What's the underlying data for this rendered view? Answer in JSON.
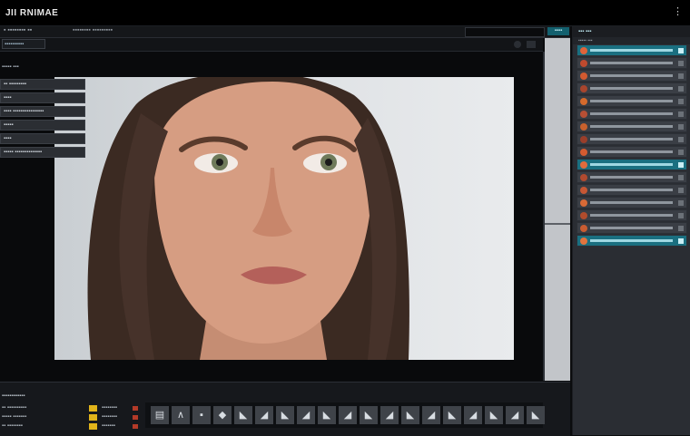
{
  "app": {
    "title": "JII RNIMAE"
  },
  "toolstrip": {
    "left_text": "▪ ▪▪▪▪▪▪▪▪ ▪▪",
    "mid_text": "▪▪▪▪▪▪▪▪ ▪▪▪▪▪▪▪▪▪",
    "badge": "▪▪▪▪"
  },
  "subbar": {
    "file_tab": "▪▪▪▪▪▪▪▪▪▪"
  },
  "viewport": {
    "label": "▪▪▪▪▪ ▪▪▪"
  },
  "properties": [
    "▪▪ ▪▪▪▪▪▪▪▪▪",
    "▪▪▪▪",
    "▪▪▪▪ ▪▪▪▪▪▪▪▪▪▪▪▪▪▪▪▪",
    "▪▪▪▪▪",
    "▪▪▪▪",
    "▪▪▪▪▪ ▪▪▪▪▪▪▪▪▪▪▪▪▪▪"
  ],
  "right_panel": {
    "header": "▪▪▪ ▪▪▪",
    "subheader": "▪▪▪▪▪ ▪▪▪"
  },
  "layers": [
    {
      "active": true,
      "color": "#e0643a"
    },
    {
      "active": false,
      "color": "#c04a2e"
    },
    {
      "active": false,
      "color": "#d25a30"
    },
    {
      "active": false,
      "color": "#a8452d"
    },
    {
      "active": false,
      "color": "#d56a2c"
    },
    {
      "active": false,
      "color": "#b84f34"
    },
    {
      "active": false,
      "color": "#c8612d"
    },
    {
      "active": false,
      "color": "#9a3e2a"
    },
    {
      "active": false,
      "color": "#d45b30"
    },
    {
      "active": true,
      "color": "#e06b3c"
    },
    {
      "active": false,
      "color": "#b14a2f"
    },
    {
      "active": false,
      "color": "#c75734"
    },
    {
      "active": false,
      "color": "#d86a36"
    },
    {
      "active": false,
      "color": "#b24c2c"
    },
    {
      "active": false,
      "color": "#c95c31"
    },
    {
      "active": true,
      "color": "#e2743e"
    }
  ],
  "timeline": {
    "header": "▪▪▪▪▪▪▪▪▪▪▪▪",
    "rows": [
      {
        "label": "▪▪ ▪▪▪▪▪▪▪▪▪▪",
        "label2": "▪▪▪▪▪▪▪▪"
      },
      {
        "label": "▪▪▪▪▪ ▪▪▪▪▪▪▪",
        "label2": "▪▪▪▪▪▪▪▪"
      },
      {
        "label": "▪▪ ▪▪▪▪▪▪▪▪",
        "label2": "▪▪▪▪▪▪▪"
      }
    ],
    "frame_icons": [
      "▤",
      "∧",
      "▪",
      "◆",
      "◣",
      "◢",
      "◣",
      "◢",
      "◣",
      "◢",
      "◣",
      "◢",
      "◣",
      "◢",
      "◣",
      "◢",
      "◣",
      "◢",
      "◣"
    ]
  },
  "colors": {
    "accent": "#1a6f80",
    "timeline_marker": "#e1b41a",
    "record_marker": "#b43a28"
  }
}
